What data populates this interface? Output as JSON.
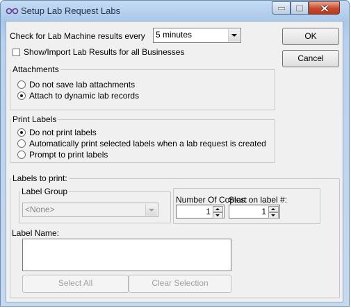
{
  "window": {
    "title": "Setup Lab Request Labs",
    "icon": "lab-glasses-icon"
  },
  "check_interval": {
    "label": "Check for Lab Machine results every",
    "value": "5 minutes"
  },
  "show_import_all": {
    "label": "Show/Import Lab Results for all Businesses",
    "checked": false
  },
  "buttons": {
    "ok": "OK",
    "cancel": "Cancel",
    "select_all": "Select All",
    "clear_selection": "Clear Selection"
  },
  "attachments": {
    "title": "Attachments",
    "options": [
      {
        "label": "Do not save lab attachments",
        "selected": false
      },
      {
        "label": "Attach to dynamic lab records",
        "selected": true
      }
    ]
  },
  "print_labels": {
    "title": "Print Labels",
    "options": [
      {
        "label": "Do not print labels",
        "selected": true
      },
      {
        "label": "Automatically print selected labels when a lab request is created",
        "selected": false
      },
      {
        "label": "Prompt to print labels",
        "selected": false
      }
    ]
  },
  "labels_to_print": {
    "title": "Labels to print:",
    "label_group": {
      "title": "Label Group",
      "value": "<None>"
    },
    "copies": {
      "label": "Number Of Copies:",
      "value": "1"
    },
    "start_label": {
      "label": "Start on label #:",
      "value": "1"
    },
    "label_name": {
      "label": "Label Name:"
    }
  }
}
